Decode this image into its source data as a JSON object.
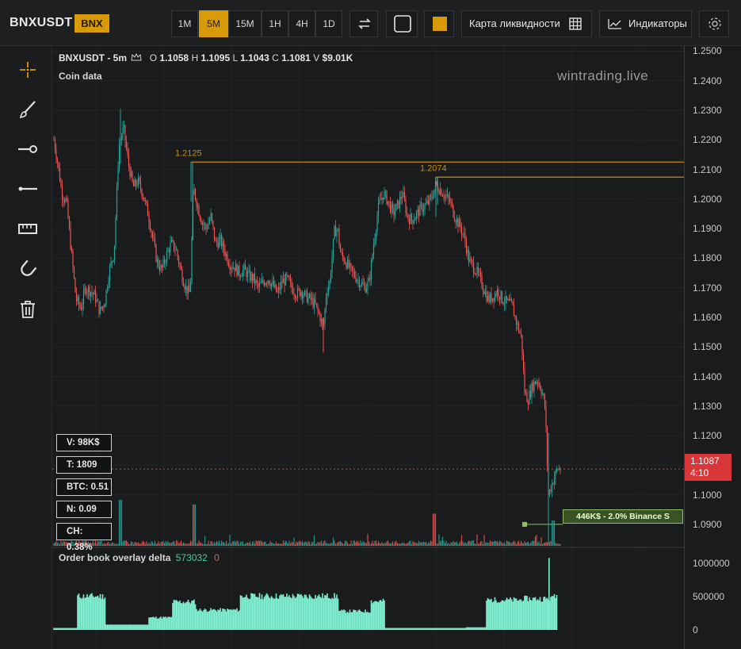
{
  "header": {
    "symbol": "BNXUSDT",
    "exchange_badge": "BNX",
    "timeframes": [
      "1M",
      "5M",
      "15M",
      "1H",
      "4H",
      "1D"
    ],
    "active_timeframe": "5M",
    "liquidity_map_label": "Карта ликвидности",
    "indicators_label": "Индикаторы"
  },
  "legend": {
    "title": "BNXUSDT - 5m",
    "o_label": "O",
    "o": "1.1058",
    "h_label": "H",
    "h": "1.1095",
    "l_label": "L",
    "l": "1.1043",
    "c_label": "C",
    "c": "1.1081",
    "v_label": "V",
    "v": "$9.01K",
    "coin_data": "Coin data"
  },
  "watermark": "wintrading.live",
  "price_axis": [
    "1.2500",
    "1.2400",
    "1.2300",
    "1.2200",
    "1.2100",
    "1.2000",
    "1.1900",
    "1.1800",
    "1.1700",
    "1.1600",
    "1.1500",
    "1.1400",
    "1.1300",
    "1.1200",
    "1.1100",
    "1.1000",
    "1.0900"
  ],
  "level_lines": [
    {
      "label": "1.2125",
      "value": 1.2125
    },
    {
      "label": "1.2074",
      "value": 1.2074
    }
  ],
  "current_price": {
    "price": "1.1087",
    "countdown": "4:10"
  },
  "order_tag": "446K$ - 2.0% Binance S",
  "stats": {
    "v": "V: 98K$",
    "t": "T: 1809",
    "btc": "BTC: 0.51",
    "n": "N: 0.09",
    "ch": "CH: 0.38%"
  },
  "subpane": {
    "title": "Order book overlay delta",
    "value_green": "573032",
    "value_red": "0",
    "axis": [
      "1000000",
      "500000",
      "0"
    ]
  },
  "colors": {
    "up": "#26a69a",
    "down": "#ef5350",
    "accent": "#d89a07",
    "level": "#c98d0a",
    "delta": "#7ff0d2"
  },
  "chart_data": {
    "type": "candlestick",
    "symbol": "BNXUSDT",
    "interval": "5m",
    "ylim": [
      1.0822,
      1.2512
    ],
    "close_path": [
      [
        0,
        1.22
      ],
      [
        5,
        1.212
      ],
      [
        10,
        1.202
      ],
      [
        16,
        1.199
      ],
      [
        22,
        1.182
      ],
      [
        28,
        1.166
      ],
      [
        34,
        1.163
      ],
      [
        40,
        1.17
      ],
      [
        46,
        1.169
      ],
      [
        52,
        1.167
      ],
      [
        58,
        1.162
      ],
      [
        64,
        1.165
      ],
      [
        70,
        1.176
      ],
      [
        76,
        1.182
      ],
      [
        82,
        1.218
      ],
      [
        88,
        1.224
      ],
      [
        94,
        1.212
      ],
      [
        100,
        1.204
      ],
      [
        106,
        1.206
      ],
      [
        112,
        1.202
      ],
      [
        118,
        1.196
      ],
      [
        124,
        1.188
      ],
      [
        130,
        1.179
      ],
      [
        136,
        1.176
      ],
      [
        142,
        1.181
      ],
      [
        148,
        1.185
      ],
      [
        154,
        1.183
      ],
      [
        160,
        1.176
      ],
      [
        166,
        1.17
      ],
      [
        172,
        1.168
      ],
      [
        176,
        1.204
      ],
      [
        180,
        1.199
      ],
      [
        186,
        1.193
      ],
      [
        192,
        1.19
      ],
      [
        198,
        1.194
      ],
      [
        204,
        1.185
      ],
      [
        210,
        1.186
      ],
      [
        216,
        1.182
      ],
      [
        222,
        1.178
      ],
      [
        228,
        1.177
      ],
      [
        234,
        1.175
      ],
      [
        240,
        1.176
      ],
      [
        246,
        1.174
      ],
      [
        252,
        1.173
      ],
      [
        258,
        1.17
      ],
      [
        264,
        1.172
      ],
      [
        270,
        1.173
      ],
      [
        276,
        1.171
      ],
      [
        282,
        1.168
      ],
      [
        288,
        1.172
      ],
      [
        294,
        1.173
      ],
      [
        300,
        1.17
      ],
      [
        306,
        1.168
      ],
      [
        312,
        1.169
      ],
      [
        318,
        1.167
      ],
      [
        324,
        1.166
      ],
      [
        330,
        1.164
      ],
      [
        336,
        1.16
      ],
      [
        340,
        1.156
      ],
      [
        344,
        1.169
      ],
      [
        348,
        1.172
      ],
      [
        354,
        1.189
      ],
      [
        358,
        1.19
      ],
      [
        362,
        1.181
      ],
      [
        368,
        1.179
      ],
      [
        374,
        1.176
      ],
      [
        380,
        1.174
      ],
      [
        386,
        1.172
      ],
      [
        392,
        1.17
      ],
      [
        398,
        1.172
      ],
      [
        404,
        1.186
      ],
      [
        410,
        1.198
      ],
      [
        416,
        1.202
      ],
      [
        422,
        1.199
      ],
      [
        428,
        1.195
      ],
      [
        434,
        1.198
      ],
      [
        440,
        1.202
      ],
      [
        446,
        1.194
      ],
      [
        452,
        1.193
      ],
      [
        458,
        1.195
      ],
      [
        464,
        1.197
      ],
      [
        470,
        1.198
      ],
      [
        476,
        1.2
      ],
      [
        482,
        1.205
      ],
      [
        488,
        1.203
      ],
      [
        494,
        1.201
      ],
      [
        500,
        1.199
      ],
      [
        506,
        1.194
      ],
      [
        512,
        1.191
      ],
      [
        518,
        1.187
      ],
      [
        524,
        1.179
      ],
      [
        530,
        1.177
      ],
      [
        536,
        1.174
      ],
      [
        542,
        1.17
      ],
      [
        548,
        1.166
      ],
      [
        554,
        1.167
      ],
      [
        560,
        1.169
      ],
      [
        566,
        1.166
      ],
      [
        572,
        1.165
      ],
      [
        578,
        1.164
      ],
      [
        584,
        1.158
      ],
      [
        590,
        1.153
      ],
      [
        594,
        1.135
      ],
      [
        598,
        1.132
      ],
      [
        604,
        1.137
      ],
      [
        610,
        1.139
      ],
      [
        616,
        1.135
      ],
      [
        620,
        1.129
      ],
      [
        624,
        1.1
      ],
      [
        630,
        1.105
      ],
      [
        636,
        1.109
      ],
      [
        640,
        1.1081
      ]
    ],
    "volume_spikes": [
      [
        84,
        1
      ],
      [
        177,
        0.9
      ],
      [
        480,
        0.7
      ],
      [
        630,
        0.55
      ]
    ],
    "subpane": {
      "series": "Order book overlay delta",
      "ylim": [
        0,
        1000000
      ],
      "approx_levels": [
        [
          0,
          30000
        ],
        [
          30,
          540000
        ],
        [
          65,
          80000
        ],
        [
          120,
          200000
        ],
        [
          150,
          450000
        ],
        [
          180,
          320000
        ],
        [
          235,
          540000
        ],
        [
          360,
          300000
        ],
        [
          400,
          460000
        ],
        [
          418,
          30000
        ],
        [
          520,
          40000
        ],
        [
          545,
          480000
        ],
        [
          590,
          500000
        ],
        [
          630,
          560000
        ],
        [
          636,
          0
        ]
      ]
    }
  }
}
